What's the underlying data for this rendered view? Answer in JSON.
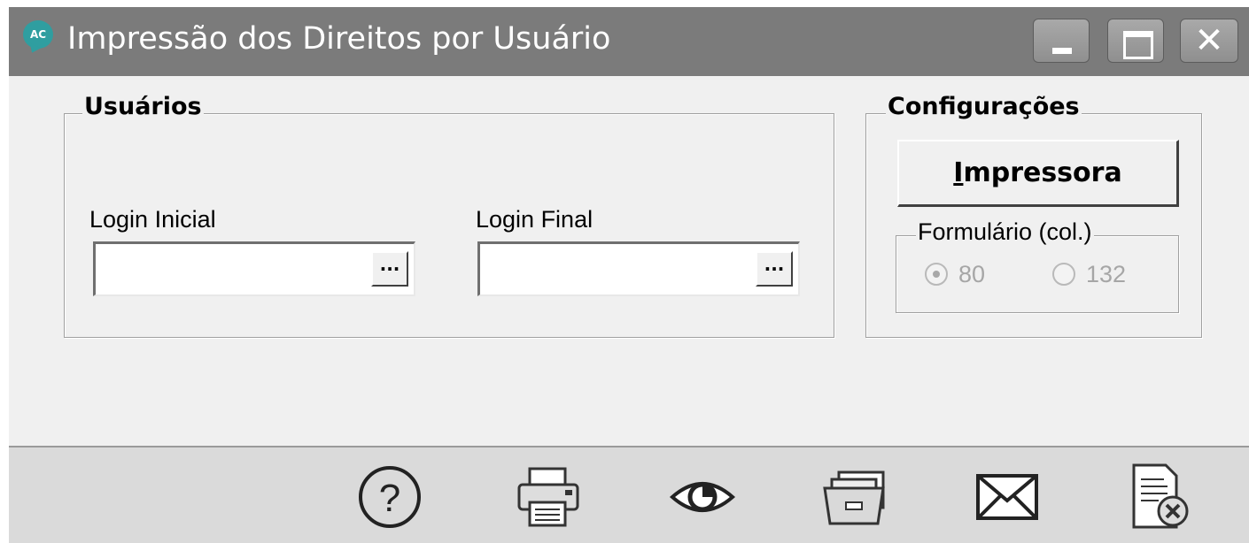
{
  "window": {
    "title": "Impressão dos Direitos por Usuário",
    "app_icon_text": "AC"
  },
  "usuarios": {
    "legend": "Usuários",
    "login_inicial_label": "Login Inicial",
    "login_inicial_value": "",
    "login_final_label": "Login Final",
    "login_final_value": "",
    "lookup_button": "..."
  },
  "config": {
    "legend": "Configurações",
    "printer_button": "Impressora",
    "form_legend": "Formulário (col.)",
    "options": [
      {
        "label": "80",
        "selected": true
      },
      {
        "label": "132",
        "selected": false
      }
    ]
  },
  "toolbar": {
    "icons": [
      "help-icon",
      "printer-icon",
      "preview-eye-icon",
      "open-folder-icon",
      "email-icon",
      "close-report-icon"
    ]
  }
}
